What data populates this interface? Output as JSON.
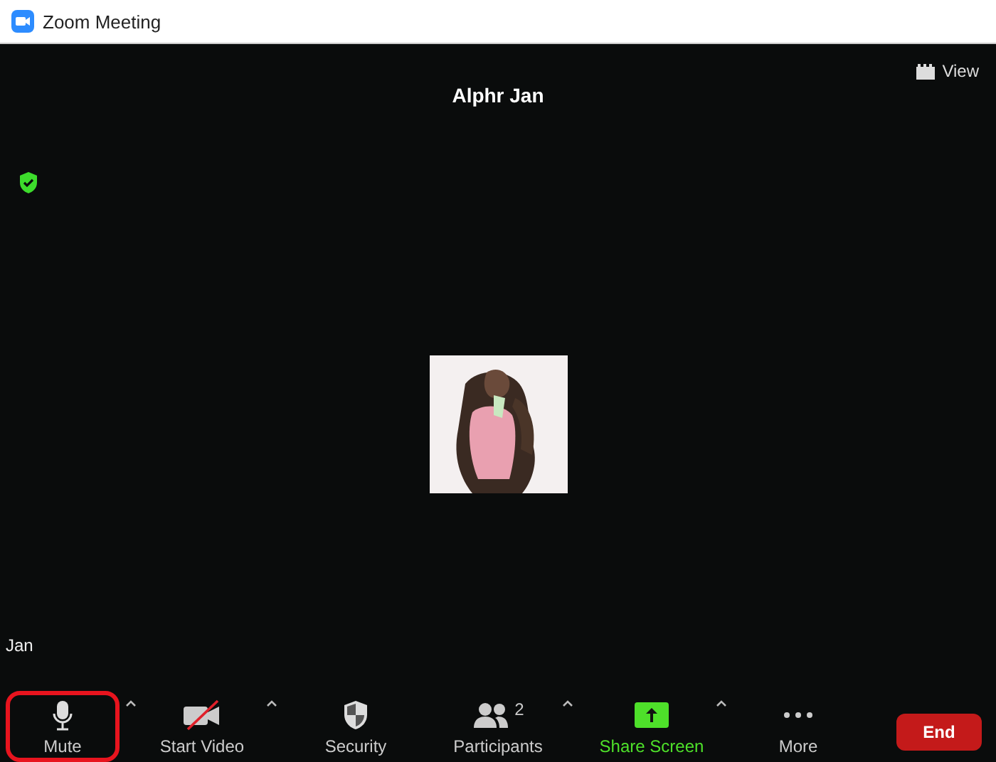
{
  "window": {
    "title": "Zoom Meeting"
  },
  "view_button": {
    "label": "View"
  },
  "speaker": {
    "name": "Alphr Jan"
  },
  "self_name": "Jan",
  "toolbar": [
    {
      "kind": "mic",
      "label": "Mute",
      "caret": true,
      "highlighted": true
    },
    {
      "kind": "video",
      "label": "Start Video",
      "caret": true,
      "highlighted": false
    },
    {
      "kind": "security",
      "label": "Security",
      "caret": false,
      "highlighted": false
    },
    {
      "kind": "participants",
      "label": "Participants",
      "count": "2",
      "caret": true,
      "highlighted": false
    },
    {
      "kind": "share",
      "label": "Share Screen",
      "caret": true,
      "highlighted": false
    },
    {
      "kind": "more",
      "label": "More",
      "caret": false,
      "highlighted": false
    }
  ],
  "end_button": {
    "label": "End"
  }
}
